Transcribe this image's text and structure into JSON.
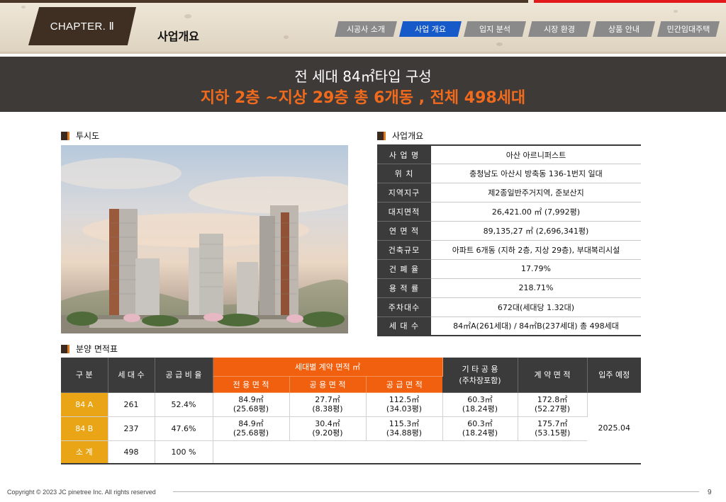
{
  "header": {
    "chapter": "CHAPTER. Ⅱ",
    "title": "사업개요",
    "nav": [
      {
        "label": "시공사 소개",
        "active": false
      },
      {
        "label": "사업 개요",
        "active": true
      },
      {
        "label": "입지 분석",
        "active": false
      },
      {
        "label": "시장 환경",
        "active": false
      },
      {
        "label": "상품 안내",
        "active": false
      },
      {
        "label": "민간임대주택",
        "active": false
      }
    ]
  },
  "banner": {
    "line1": "전 세대 84㎡타입 구성",
    "line2": "지하 2층 ~지상 29층 총 6개동 , 전체 498세대"
  },
  "render_section": {
    "title": "투시도"
  },
  "overview": {
    "title": "사업개요",
    "rows": [
      {
        "label": "사 업 명",
        "value": "아산 아르니퍼스트"
      },
      {
        "label": "위 치",
        "value": "충청남도 아산시 방축동 136-1번지 일대"
      },
      {
        "label": "지역지구",
        "value": "제2종일반주거지역, 준보산지"
      },
      {
        "label": "대지면적",
        "value": "26,421.00 ㎡ (7,992평)"
      },
      {
        "label": "연 면 적",
        "value": "89,135,27 ㎡ (2,696,341평)"
      },
      {
        "label": "건축규모",
        "value": "아파트 6개동 (지하 2층, 지상 29층), 부대복리시설"
      },
      {
        "label": "건 폐 율",
        "value": "17.79%"
      },
      {
        "label": "용 적 률",
        "value": "218.71%"
      },
      {
        "label": "주차대수",
        "value": "672대(세대당 1.32대)"
      },
      {
        "label": "세 대 수",
        "value": "84㎡A(261세대) / 84㎡B(237세대) 총 498세대"
      }
    ]
  },
  "area_table": {
    "title": "분양 면적표",
    "headers": {
      "type": "구 분",
      "units": "세 대 수",
      "ratio": "공 급 비 율",
      "contract_group": "세대별 계약 면적 ㎡",
      "exclusive": "전 용 면 적",
      "common": "공 용 면 적",
      "supply": "공 급 면 적",
      "other_common_1": "기 타 공 용",
      "other_common_2": "(주차장포함)",
      "contract": "계 약 면 적",
      "move_in": "입주 예정"
    },
    "rows": [
      {
        "type": "84 A",
        "units": "261",
        "ratio": "52.4%",
        "exclusive": [
          "84.9㎡",
          "(25.68평)"
        ],
        "common": [
          "27.7㎡",
          "(8.38평)"
        ],
        "supply": [
          "112.5㎡",
          "(34.03평)"
        ],
        "other": [
          "60.3㎡",
          "(18.24평)"
        ],
        "contract": [
          "172.8㎡",
          "(52.27평)"
        ]
      },
      {
        "type": "84 B",
        "units": "237",
        "ratio": "47.6%",
        "exclusive": [
          "84.9㎡",
          "(25.68평)"
        ],
        "common": [
          "30.4㎡",
          "(9.20평)"
        ],
        "supply": [
          "115.3㎡",
          "(34.88평)"
        ],
        "other": [
          "60.3㎡",
          "(18.24평)"
        ],
        "contract": [
          "175.7㎡",
          "(53.15평)"
        ]
      }
    ],
    "move_in_value": "2025.04",
    "subtotal": {
      "type": "소 계",
      "units": "498",
      "ratio": "100 %"
    }
  },
  "footer": {
    "copyright": "Copyright © 2023 JC pinetree Inc. All rights reserved",
    "page": "9"
  },
  "colors": {
    "accent_orange": "#f1600f",
    "banner_orange": "#f26b1d",
    "nav_active": "#1659c9",
    "type_cell": "#e9a516",
    "dark": "#3b3b3b"
  }
}
